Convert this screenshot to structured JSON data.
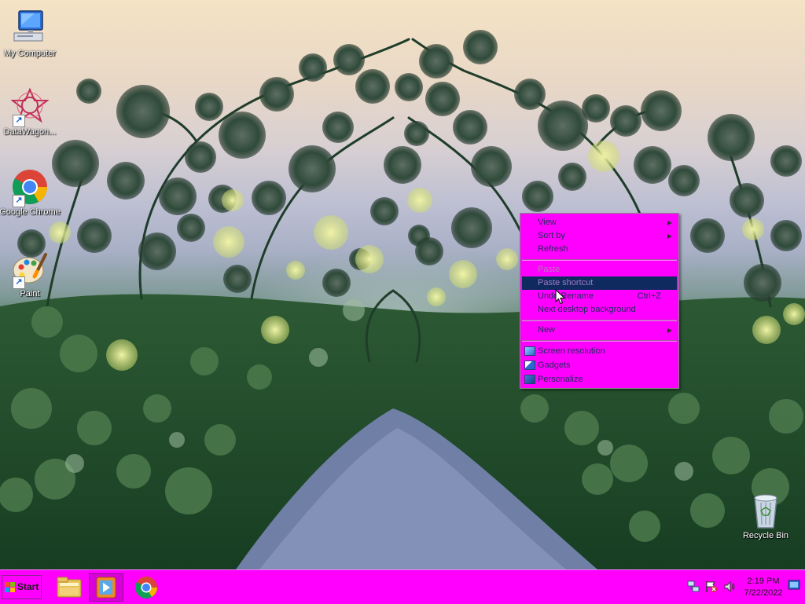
{
  "desktop": {
    "icons": [
      {
        "label": "My Computer",
        "icon": "computer-icon"
      },
      {
        "label": "DataWagon...",
        "icon": "datawagon-icon"
      },
      {
        "label": "Google Chrome",
        "icon": "chrome-icon"
      },
      {
        "label": "Paint",
        "icon": "paint-icon"
      },
      {
        "label": "Recycle Bin",
        "icon": "recycle-bin-icon"
      }
    ]
  },
  "context_menu": {
    "items": [
      {
        "label": "View",
        "submenu": true
      },
      {
        "label": "Sort by",
        "submenu": true
      },
      {
        "label": "Refresh"
      },
      {
        "label": "Paste",
        "disabled": true
      },
      {
        "label": "Paste shortcut",
        "disabled": true,
        "highlighted": true
      },
      {
        "label": "Undo Rename",
        "shortcut": "Ctrl+Z"
      },
      {
        "label": "Next desktop background"
      },
      {
        "label": "New",
        "submenu": true
      },
      {
        "label": "Screen resolution",
        "icon": "screen-resolution-icon"
      },
      {
        "label": "Gadgets",
        "icon": "gadgets-icon"
      },
      {
        "label": "Personalize",
        "icon": "personalize-icon"
      }
    ]
  },
  "taskbar": {
    "start_label": "Start",
    "pinned": [
      {
        "name": "Windows Explorer",
        "icon": "folder-icon"
      },
      {
        "name": "Windows Media Player",
        "icon": "media-player-icon",
        "active": true
      },
      {
        "name": "Google Chrome",
        "icon": "chrome-icon"
      }
    ],
    "tray": {
      "icons": [
        "network-icon",
        "action-center-flag-icon",
        "volume-icon"
      ],
      "time": "2:19 PM",
      "date": "7/22/2022"
    }
  },
  "colors": {
    "taskbar": "#ff00ff",
    "menu": "#ff00ff",
    "menu_highlight": "#0f2a5f"
  }
}
